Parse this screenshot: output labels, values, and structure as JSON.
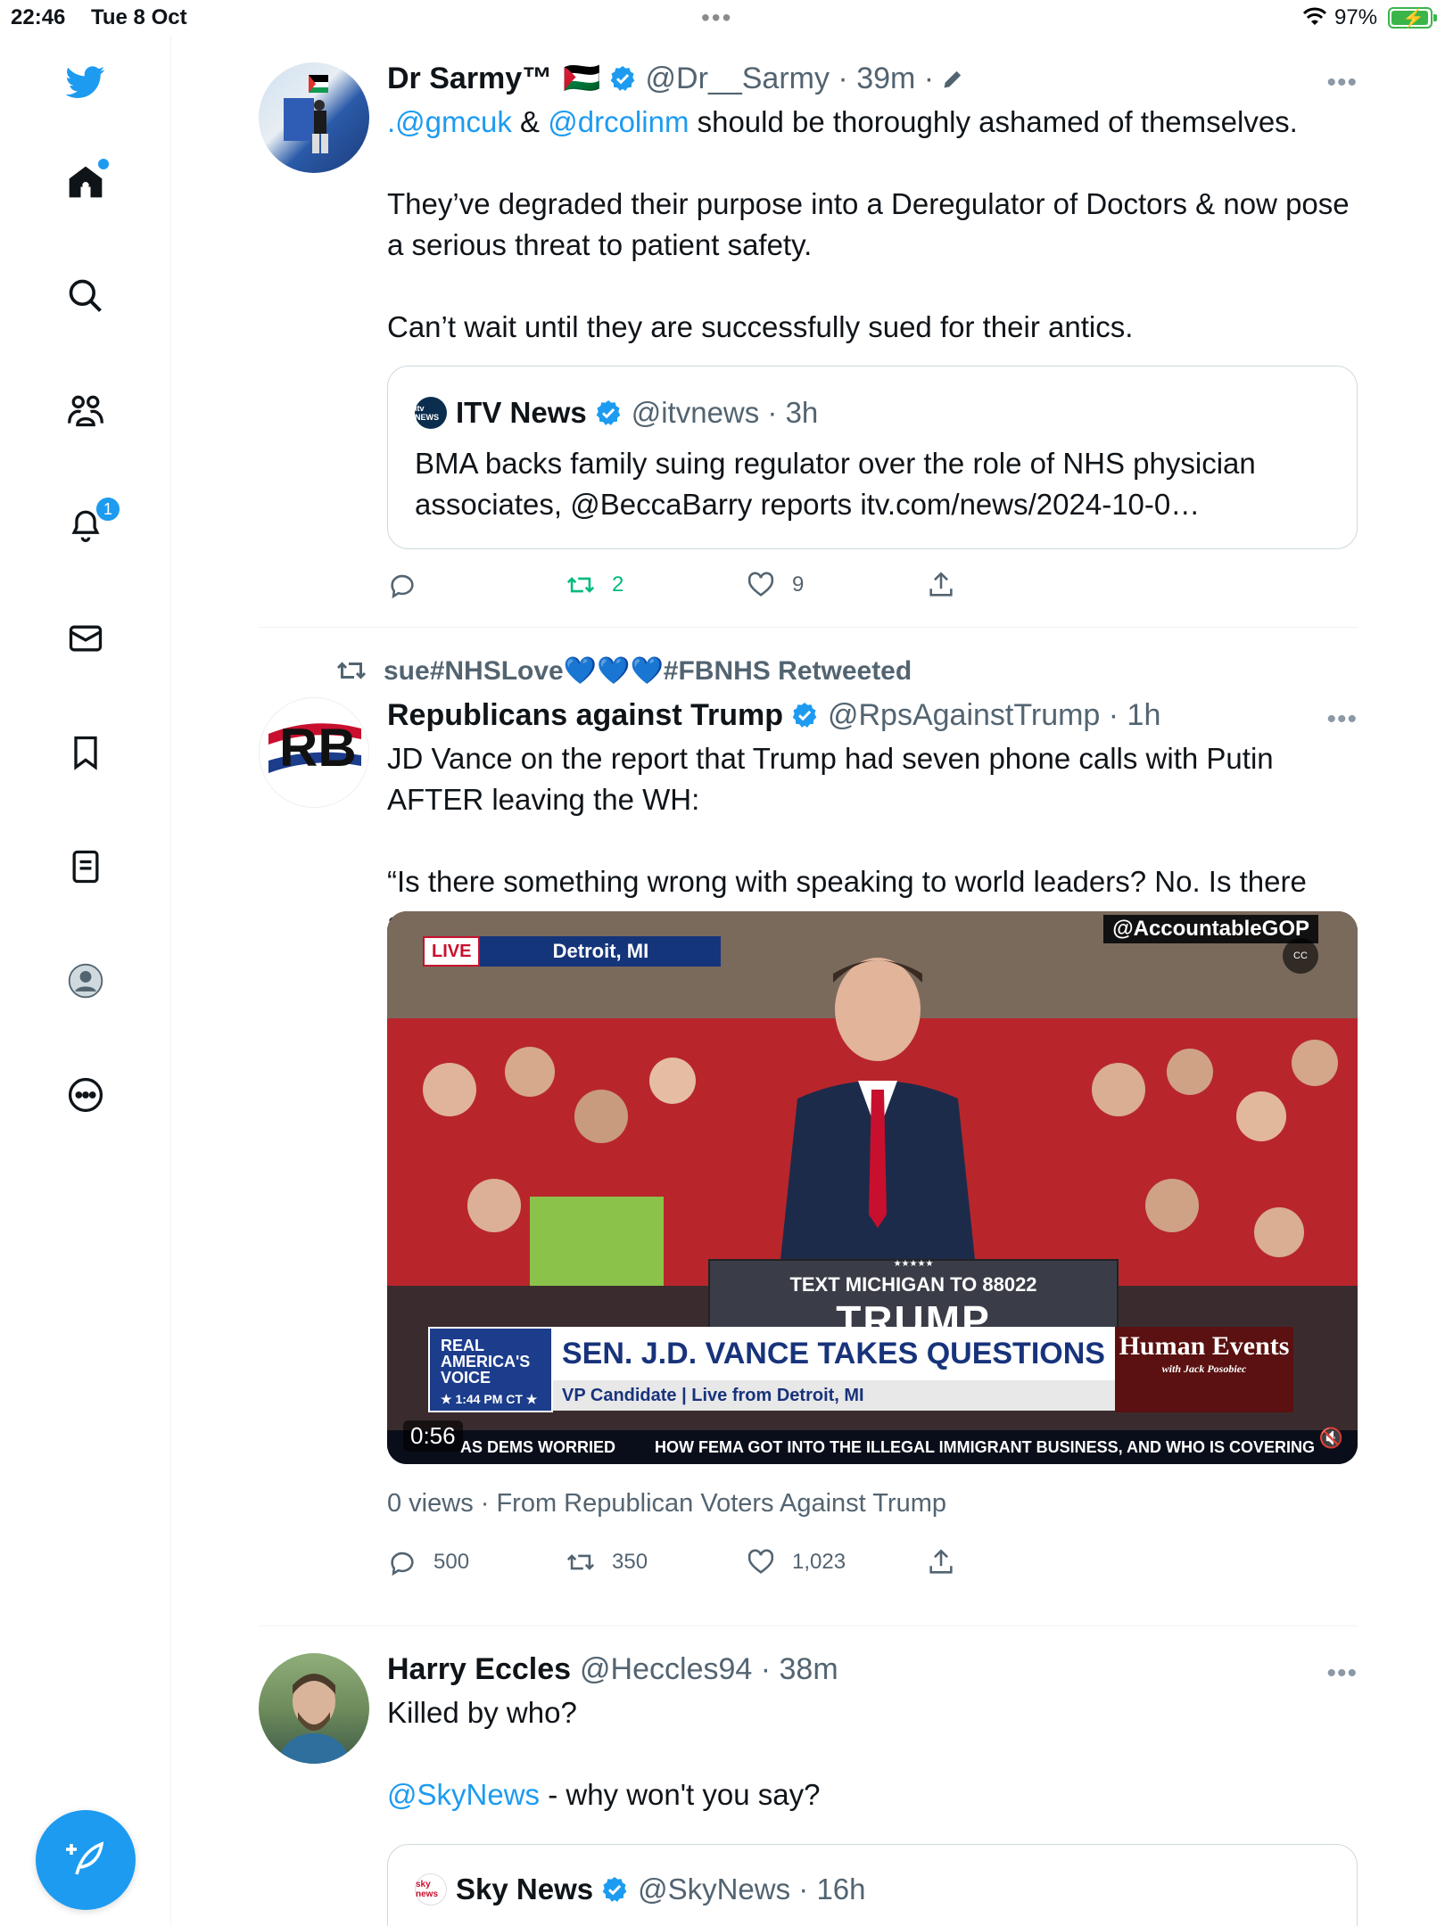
{
  "status_bar": {
    "time": "22:46",
    "date": "Tue 8 Oct",
    "dots": "•••",
    "battery_pct": "97%",
    "battery_level": 0.97
  },
  "sidebar": {
    "notifications_count": "1",
    "accent_color": "#1d9bf0"
  },
  "tweets": [
    {
      "name": "Dr Sarmy™",
      "flag": "🇵🇸",
      "handle": "@Dr__Sarmy · 39m ·",
      "text_mention1": ".@gmcuk",
      "text_amp": " & ",
      "text_mention2": "@drcolinm",
      "text_rest1": " should be thoroughly ashamed of themselves.",
      "text_p2": "They’ve degraded their purpose into a Deregulator of Doctors & now pose a serious threat to patient safety.",
      "text_p3": "Can’t wait until they are successfully sued for their antics.",
      "quote": {
        "logo": "itv NEWS",
        "name": "ITV News",
        "handle": "@itvnews · 3h",
        "text": "BMA backs family suing regulator over the role of NHS physician associates, @BeccaBarry reports  itv.com/news/2024-10-0…"
      },
      "actions": {
        "replies": "",
        "retweets": "2",
        "likes": "9"
      }
    },
    {
      "retweeted_by": "sue#NHSLove💙💙💙#FBNHS Retweeted",
      "avatar_text": "RB",
      "name": "Republicans against Trump",
      "handle": "@RpsAgainstTrump · 1h",
      "text_p1": "JD Vance on the report that Trump had seven phone calls with Putin AFTER leaving the WH:",
      "text_p2": "“Is there something wrong with speaking to world leaders? No. Is there anything wrong with engaging in diplomacy?”",
      "video": {
        "tag": "@AccountableGOP",
        "cc": "CC",
        "live": "LIVE",
        "location": "Detroit, MI",
        "podium_line1": "★★★★★",
        "podium_line2": "TEXT MICHIGAN TO 88022",
        "podium_line3": "TRUMP",
        "network": "REAL AMERICA'S VOICE",
        "network_time": "★ 1:44 PM CT ★",
        "headline": "SEN. J.D. VANCE TAKES QUESTIONS",
        "subline": "VP Candidate | Live from Detroit, MI",
        "show_title": "Human Events",
        "show_sub": "with Jack Posobiec",
        "ticker1": "AS DEMS WORRIED",
        "ticker2": "HOW FEMA GOT INTO THE ILLEGAL IMMIGRANT BUSINESS, AND WHO IS COVERING",
        "duration": "0:56",
        "mute_icon": "🔇"
      },
      "meta": "0 views · From Republican Voters Against Trump",
      "actions": {
        "replies": "500",
        "retweets": "350",
        "likes": "1,023"
      }
    },
    {
      "name": "Harry Eccles",
      "handle": "@Heccles94 · 38m",
      "text_p1": "Killed by who?",
      "text_mention": "@SkyNews",
      "text_rest": " - why won't you say?",
      "quote": {
        "logo": "sky news",
        "name": "Sky News",
        "handle": "@SkyNews · 16h"
      }
    }
  ],
  "more_label": "•••"
}
